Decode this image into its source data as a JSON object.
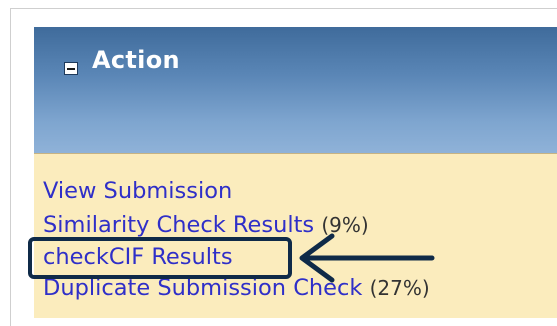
{
  "panel": {
    "title": "Action",
    "links": [
      {
        "label": "View Submission",
        "suffix": ""
      },
      {
        "label": "Similarity Check Results",
        "suffix": "(9%)"
      },
      {
        "label": "checkCIF Results",
        "suffix": ""
      },
      {
        "label": "Duplicate Submission Check",
        "suffix": "(27%)"
      }
    ]
  },
  "colors": {
    "header_top": "#3f6b9b",
    "header_bottom": "#8fb2d8",
    "body_background": "#fbecbd",
    "link": "#2f2fc8",
    "callout": "#0f2a48"
  },
  "icons": {
    "collapse": "minus-box-icon",
    "callout_arrow": "left-arrow-icon"
  }
}
